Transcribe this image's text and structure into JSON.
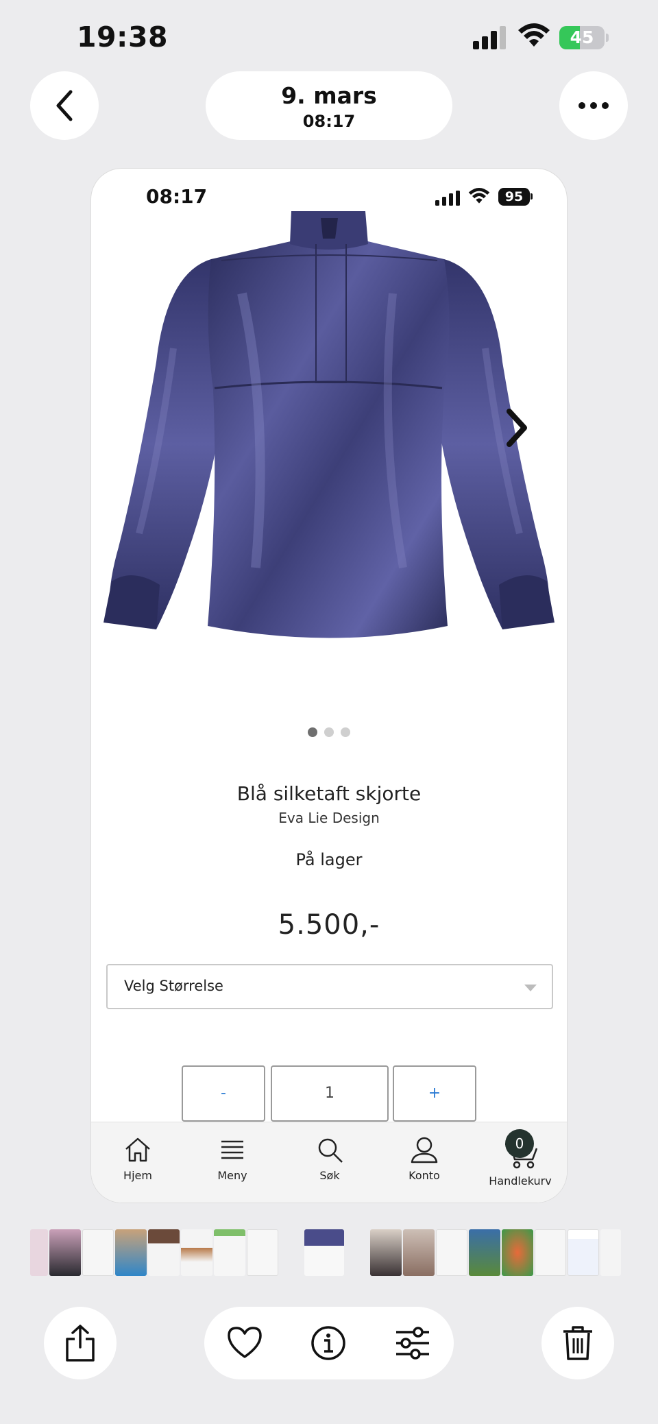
{
  "os_status": {
    "time": "19:38",
    "battery_level": "45",
    "battery_percent": 45,
    "charging": true,
    "icons": [
      "cellular-signal-icon",
      "wifi-icon",
      "battery-charging-icon"
    ]
  },
  "photos_header": {
    "date": "9. mars",
    "time": "08:17",
    "back_icon": "chevron-left-icon",
    "more_icon": "ellipsis-icon"
  },
  "screenshot": {
    "status": {
      "time": "08:17",
      "battery_level": "95"
    },
    "carousel": {
      "image_subject": "blue silk taffeta blouse",
      "image_color": "#3d3f78",
      "next_icon": "chevron-right-icon",
      "page_count": 3,
      "active_index": 0
    },
    "product": {
      "title": "Blå silketaft skjorte",
      "brand": "Eva Lie Design",
      "stock": "På lager",
      "price": "5.500,-"
    },
    "size_select": {
      "placeholder": "Velg Størrelse"
    },
    "quantity": {
      "minus": "-",
      "value": "1",
      "plus": "+"
    },
    "bottom_nav": {
      "items": [
        {
          "label": "Hjem",
          "icon": "home-icon"
        },
        {
          "label": "Meny",
          "icon": "menu-icon"
        },
        {
          "label": "Søk",
          "icon": "search-icon"
        },
        {
          "label": "Konto",
          "icon": "account-icon"
        },
        {
          "label": "Handlekurv",
          "icon": "cart-icon"
        }
      ],
      "cart_count": "0"
    }
  },
  "toolbar": {
    "share_icon": "share-icon",
    "favorite_icon": "heart-icon",
    "info_icon": "info-icon",
    "adjust_icon": "sliders-icon",
    "delete_icon": "trash-icon"
  },
  "colors": {
    "background": "#ececee",
    "battery_green": "#35c759",
    "link_blue": "#2b7bd4",
    "cart_badge": "#24332e"
  }
}
